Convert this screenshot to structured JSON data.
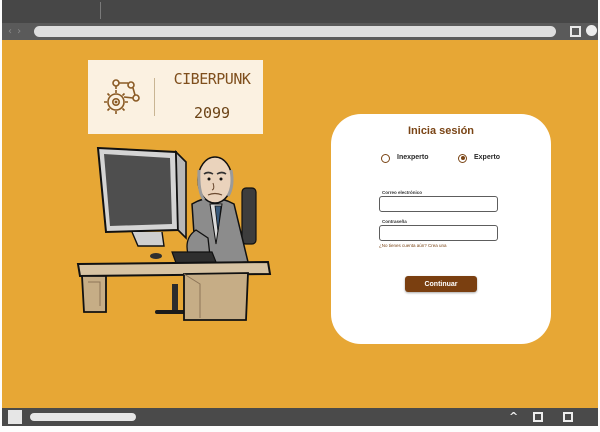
{
  "browser": {
    "nav_arrows": "‹ ›"
  },
  "logo": {
    "title": "CIBERPUNK",
    "year": "2099"
  },
  "login": {
    "title": "Inicia sesión",
    "options": [
      {
        "label": "Inexperto",
        "selected": false
      },
      {
        "label": "Experto",
        "selected": true
      }
    ],
    "email_label": "Correo electrónico",
    "email_value": "",
    "password_label": "Contraseña",
    "password_value": "",
    "signup_link": "¿No tienes cuenta aún? Crea una",
    "submit_label": "Continuar"
  },
  "taskbar": {
    "chevron": "^"
  },
  "colors": {
    "page_background": "#e7a735",
    "brand_brown": "#7a3f10",
    "card_background": "#ffffff"
  }
}
